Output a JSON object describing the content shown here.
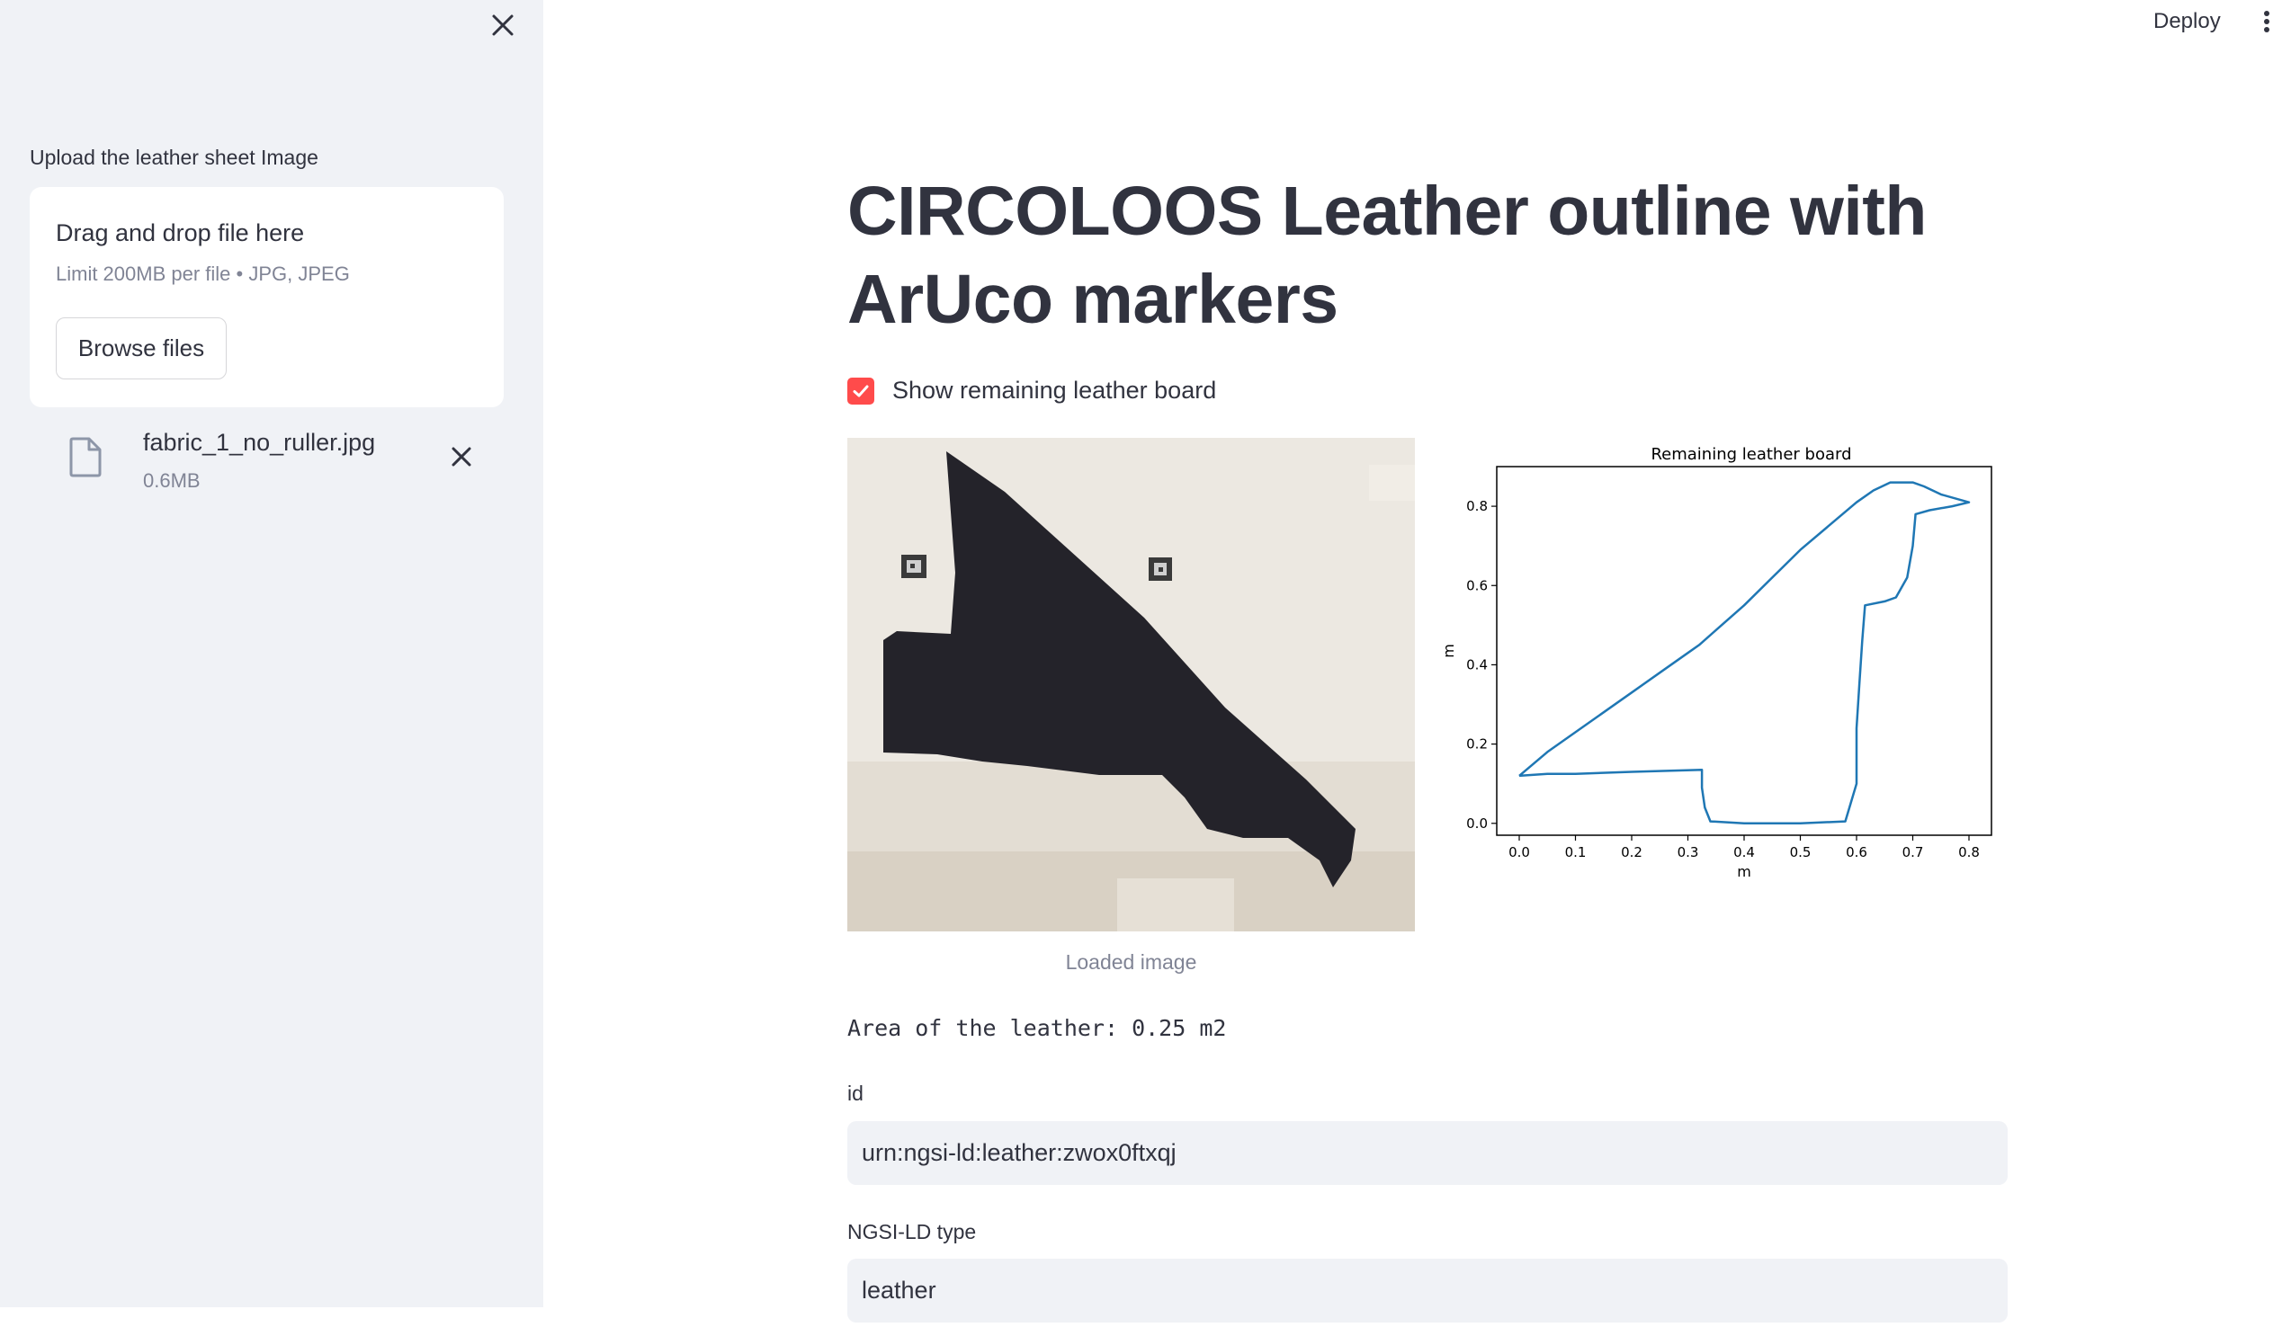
{
  "sidebar": {
    "upload_label": "Upload the leather sheet Image",
    "dropzone": {
      "main_text": "Drag and drop file here",
      "limit_text": "Limit 200MB per file • JPG, JPEG",
      "browse_label": "Browse files"
    },
    "file": {
      "name": "fabric_1_no_ruller.jpg",
      "size": "0.6MB"
    }
  },
  "header": {
    "deploy_label": "Deploy"
  },
  "main": {
    "title": "CIRCOLOOS Leather outline with ArUco markers",
    "checkbox_label": "Show remaining leather board",
    "checkbox_checked": true,
    "image_caption": "Loaded image",
    "area_text": "Area of the leather: 0.25 m2",
    "id_label": "id",
    "id_value": "urn:ngsi-ld:leather:zwox0ftxqj",
    "type_label": "NGSI-LD type",
    "type_value": "leather"
  },
  "colors": {
    "accent": "#ff4b4b",
    "sidebar_bg": "#f0f2f6",
    "text": "#31333f",
    "muted": "#808495",
    "line": "#1f77b4"
  },
  "chart_data": {
    "type": "line",
    "title": "Remaining leather board",
    "xlabel": "m",
    "ylabel": "m",
    "xlim": [
      -0.04,
      0.84
    ],
    "ylim": [
      -0.03,
      0.9
    ],
    "xticks": [
      "0.0",
      "0.1",
      "0.2",
      "0.3",
      "0.4",
      "0.5",
      "0.6",
      "0.7",
      "0.8"
    ],
    "yticks": [
      "0.0",
      "0.2",
      "0.4",
      "0.6",
      "0.8"
    ],
    "grid": false,
    "series": [
      {
        "x": [
          0.0,
          0.05,
          0.1,
          0.15,
          0.2,
          0.25,
          0.3,
          0.32,
          0.36,
          0.4,
          0.45,
          0.5,
          0.55,
          0.6,
          0.63,
          0.66,
          0.7,
          0.72,
          0.75,
          0.8,
          0.77,
          0.73,
          0.705,
          0.7,
          0.69,
          0.67,
          0.65,
          0.615,
          0.61,
          0.605,
          0.6,
          0.6,
          0.58,
          0.5,
          0.4,
          0.34,
          0.33,
          0.325,
          0.325,
          0.2,
          0.1,
          0.05,
          0.0
        ],
        "y": [
          0.12,
          0.18,
          0.23,
          0.28,
          0.33,
          0.38,
          0.43,
          0.45,
          0.5,
          0.55,
          0.62,
          0.69,
          0.75,
          0.81,
          0.84,
          0.86,
          0.86,
          0.85,
          0.83,
          0.81,
          0.8,
          0.79,
          0.78,
          0.7,
          0.62,
          0.57,
          0.56,
          0.55,
          0.46,
          0.35,
          0.24,
          0.1,
          0.005,
          0.0,
          0.0,
          0.005,
          0.04,
          0.09,
          0.135,
          0.13,
          0.125,
          0.125,
          0.12
        ]
      }
    ]
  }
}
